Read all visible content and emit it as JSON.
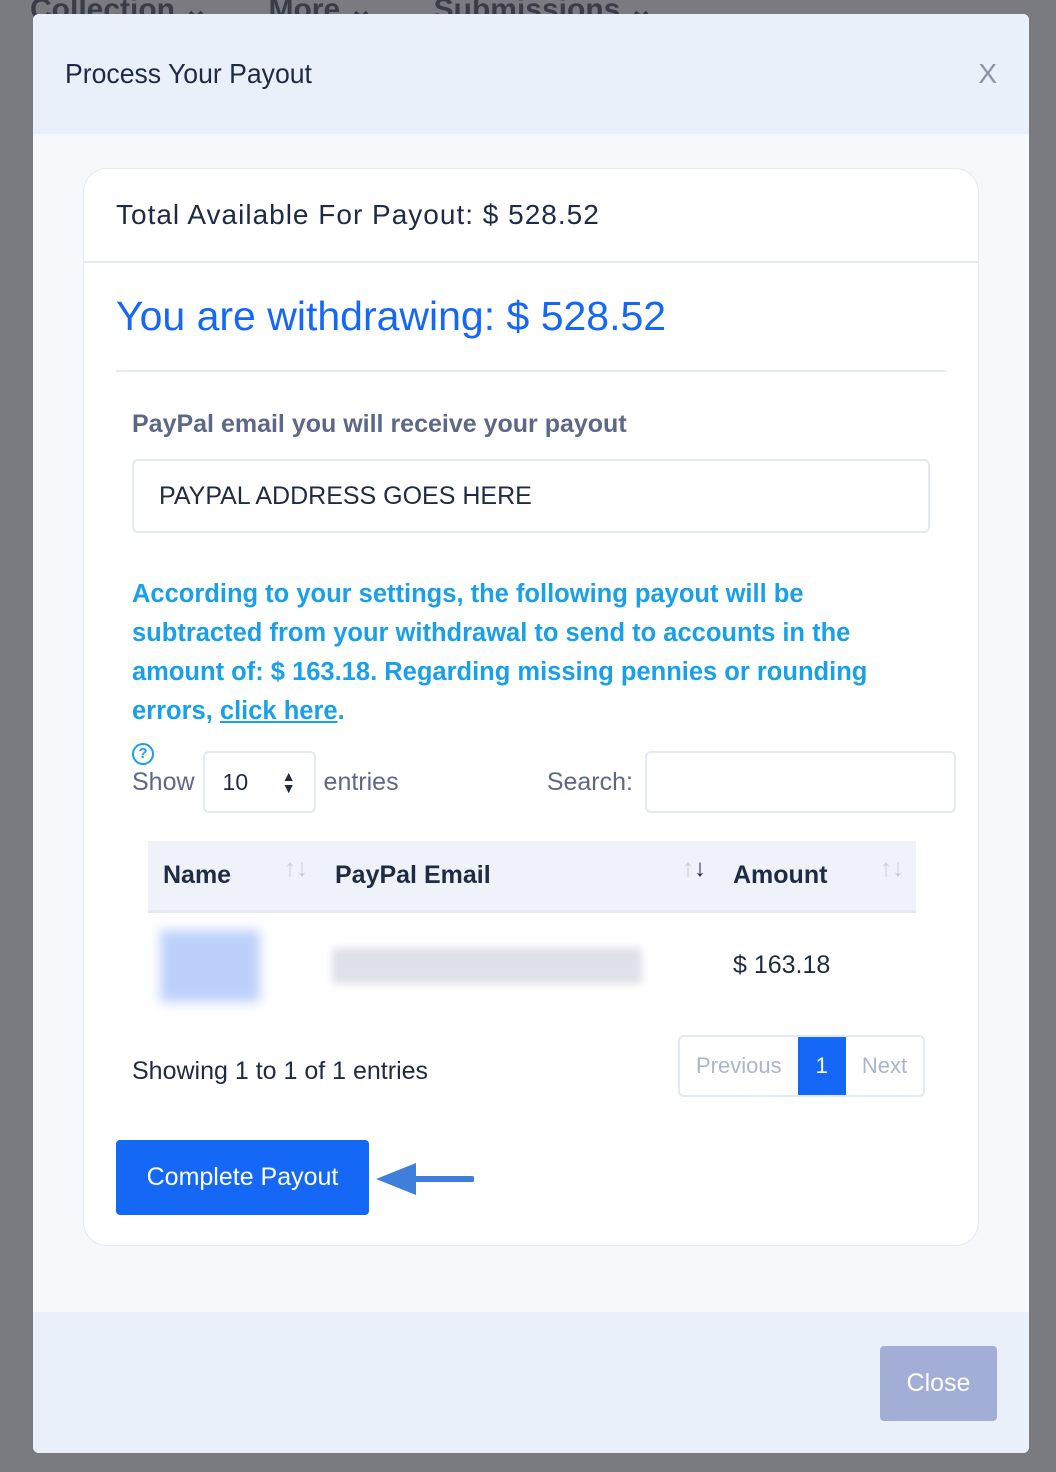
{
  "background_nav": [
    "Collection ⌄",
    "More ⌄",
    "Submissions ⌄"
  ],
  "modal": {
    "title": "Process Your Payout",
    "close_x": "X"
  },
  "card": {
    "total": "Total Available For Payout: $ 528.52",
    "withdrawing": "You are withdrawing: $ 528.52",
    "email_label": "PayPal email you will receive your payout",
    "email_value": "PAYPAL ADDRESS GOES HERE",
    "note_text": "According to your settings, the following payout will be subtracted from your withdrawal to send to accounts in the amount of: $ 163.18. Regarding missing pennies or rounding errors, ",
    "note_link": "click here",
    "note_end": ".",
    "help_icon": "?"
  },
  "table_controls": {
    "show": "Show",
    "entries_value": "10",
    "entries": "entries",
    "search": "Search:",
    "search_value": ""
  },
  "table": {
    "headers": [
      "Name",
      "PayPal Email",
      "Amount"
    ],
    "rows": [
      {
        "amount": "$ 163.18"
      }
    ]
  },
  "pagination": {
    "info": "Showing 1 to 1 of 1 entries",
    "previous": "Previous",
    "current": "1",
    "next": "Next"
  },
  "buttons": {
    "complete": "Complete Payout",
    "close": "Close"
  },
  "colors": {
    "primary": "#1468f5",
    "note": "#1aa0e8",
    "close_button": "#a3aed6"
  }
}
